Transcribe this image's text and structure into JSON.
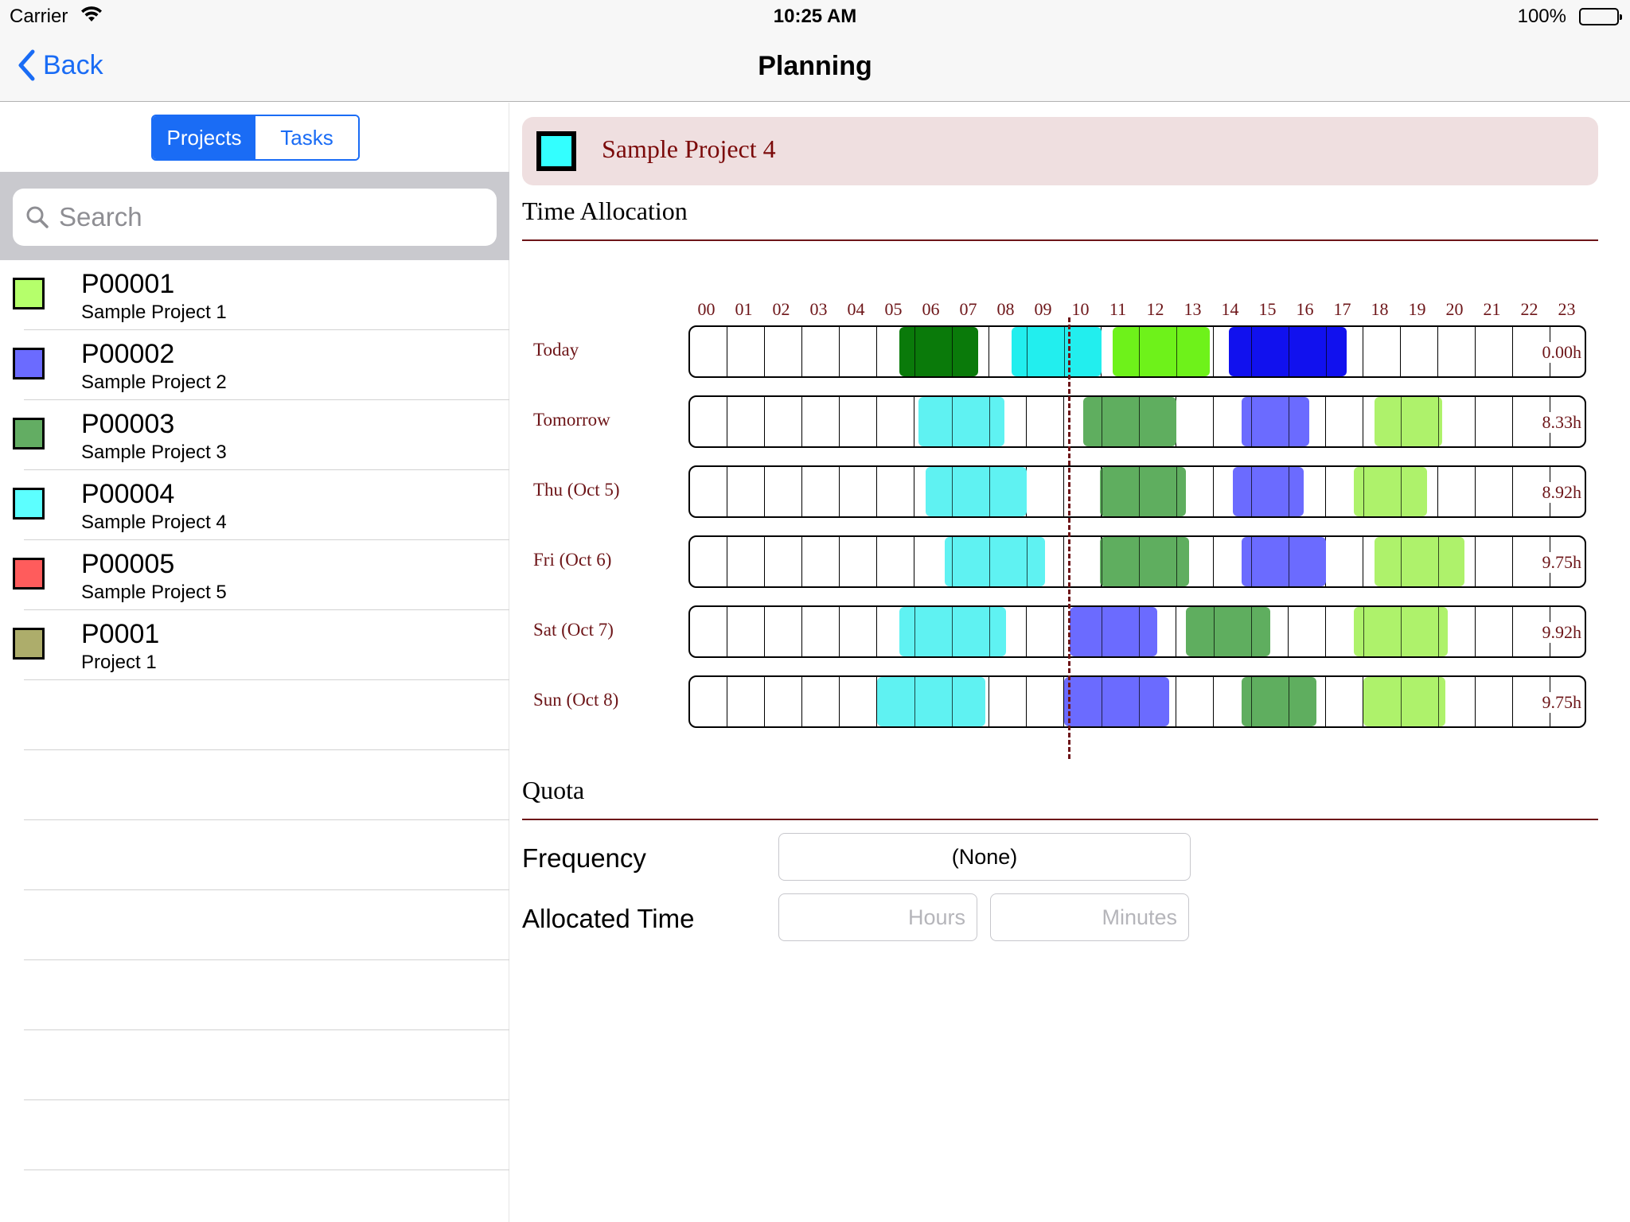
{
  "status_bar": {
    "carrier": "Carrier",
    "time": "10:25 AM",
    "battery": "100%"
  },
  "nav": {
    "back_label": "Back",
    "title": "Planning"
  },
  "segments": [
    {
      "label": "Projects",
      "active": true
    },
    {
      "label": "Tasks",
      "active": false
    }
  ],
  "search": {
    "placeholder": "Search",
    "value": ""
  },
  "projects": [
    {
      "code": "P00001",
      "name": "Sample Project 1",
      "color": "#b5ff6b"
    },
    {
      "code": "P00002",
      "name": "Sample Project 2",
      "color": "#6b6bff"
    },
    {
      "code": "P00003",
      "name": "Sample Project 3",
      "color": "#63ad63"
    },
    {
      "code": "P00004",
      "name": "Sample Project 4",
      "color": "#5cffff"
    },
    {
      "code": "P00005",
      "name": "Sample Project 5",
      "color": "#ff5c5c"
    },
    {
      "code": "P0001",
      "name": "Project 1",
      "color": "#adad6b"
    }
  ],
  "detail": {
    "project_title": "Sample Project 4",
    "project_color": "#33ffff",
    "time_allocation_title": "Time Allocation",
    "hours": [
      "00",
      "01",
      "02",
      "03",
      "04",
      "05",
      "06",
      "07",
      "08",
      "09",
      "10",
      "11",
      "12",
      "13",
      "14",
      "15",
      "16",
      "17",
      "18",
      "19",
      "20",
      "21",
      "22",
      "23"
    ],
    "now_hour": 10.15,
    "days": [
      {
        "label": "Today",
        "total": "0.00h",
        "blocks": [
          {
            "start": 5.6,
            "end": 7.7,
            "color": "#0a7a0a"
          },
          {
            "start": 8.6,
            "end": 11.0,
            "color": "#22eeee"
          },
          {
            "start": 11.3,
            "end": 13.9,
            "color": "#6ef21a"
          },
          {
            "start": 14.4,
            "end": 17.55,
            "color": "#1111ee"
          }
        ]
      },
      {
        "label": "Tomorrow",
        "total": "8.33h",
        "blocks": [
          {
            "start": 6.1,
            "end": 8.4,
            "color": "#5ff2f2"
          },
          {
            "start": 10.5,
            "end": 13.0,
            "color": "#5fae5f"
          },
          {
            "start": 14.75,
            "end": 16.55,
            "color": "#6b6bff"
          },
          {
            "start": 18.3,
            "end": 20.1,
            "color": "#aef26b"
          }
        ]
      },
      {
        "label": "Thu (Oct 5)",
        "total": "8.92h",
        "blocks": [
          {
            "start": 6.3,
            "end": 9.0,
            "color": "#5ff2f2"
          },
          {
            "start": 10.95,
            "end": 13.25,
            "color": "#5fae5f"
          },
          {
            "start": 14.5,
            "end": 16.4,
            "color": "#6b6bff"
          },
          {
            "start": 17.75,
            "end": 19.7,
            "color": "#aef26b"
          }
        ]
      },
      {
        "label": "Fri (Oct 6)",
        "total": "9.75h",
        "blocks": [
          {
            "start": 6.8,
            "end": 9.5,
            "color": "#5ff2f2"
          },
          {
            "start": 10.95,
            "end": 13.35,
            "color": "#5fae5f"
          },
          {
            "start": 14.75,
            "end": 17.0,
            "color": "#6b6bff"
          },
          {
            "start": 18.3,
            "end": 20.7,
            "color": "#aef26b"
          }
        ]
      },
      {
        "label": "Sat (Oct 7)",
        "total": "9.92h",
        "blocks": [
          {
            "start": 5.6,
            "end": 8.45,
            "color": "#5ff2f2"
          },
          {
            "start": 10.15,
            "end": 12.5,
            "color": "#6b6bff"
          },
          {
            "start": 13.25,
            "end": 15.5,
            "color": "#5fae5f"
          },
          {
            "start": 17.75,
            "end": 20.25,
            "color": "#aef26b"
          }
        ]
      },
      {
        "label": "Sun (Oct 8)",
        "total": "9.75h",
        "blocks": [
          {
            "start": 5.0,
            "end": 7.9,
            "color": "#5ff2f2"
          },
          {
            "start": 10.0,
            "end": 12.8,
            "color": "#6b6bff"
          },
          {
            "start": 14.75,
            "end": 16.75,
            "color": "#5fae5f"
          },
          {
            "start": 18.0,
            "end": 20.2,
            "color": "#aef26b"
          }
        ]
      }
    ],
    "quota_title": "Quota",
    "frequency_label": "Frequency",
    "frequency_value": "(None)",
    "allocated_label": "Allocated Time",
    "hours_placeholder": "Hours",
    "minutes_placeholder": "Minutes"
  }
}
